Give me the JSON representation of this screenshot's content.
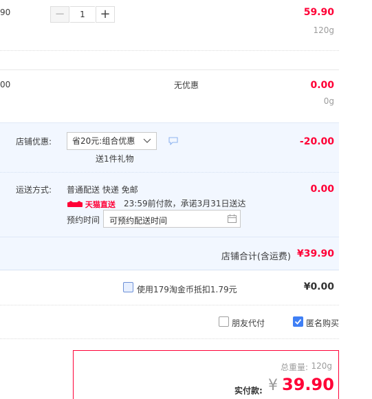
{
  "item1": {
    "price_partial": "90",
    "quantity": "1",
    "minus": "−",
    "plus": "+",
    "total": "59.90",
    "weight": "120g"
  },
  "item2": {
    "price_partial": "00",
    "promo": "无优惠",
    "total": "0.00",
    "weight": "0g"
  },
  "shop_discount": {
    "label": "店铺优惠:",
    "selected": "省20元:组合优惠",
    "gift": "送1件礼物",
    "amount": "-20.00"
  },
  "shipping": {
    "label": "运送方式:",
    "method": "普通配送 快递 免邮",
    "badge": "天猫直送",
    "promise": "23:59前付款，承诺3月31日送达",
    "schedule_label": "预约时间",
    "schedule_placeholder": "可预约配送时间",
    "amount": "0.00"
  },
  "shop_total": {
    "label": "店铺合计(含运费)",
    "amount": "¥39.90"
  },
  "coin": {
    "label": "使用179淘金币抵扣1.79元",
    "amount": "¥0.00"
  },
  "options": {
    "friend_pay": "朋友代付",
    "anonymous": "匿名购买"
  },
  "summary": {
    "weight_label": "总重量:",
    "weight": "120g",
    "pay_label": "实付款:",
    "currency": "¥",
    "amount": "39.90"
  },
  "colors": {
    "accent_red": "#ff0036",
    "light_blue": "#f2f7ff",
    "check_blue": "#3f7ff5"
  },
  "icons": {
    "chat": "chat-bubble-icon",
    "calendar": "calendar-icon",
    "tmall": "tmall-cat-icon",
    "chevron": "chevron-down-icon"
  }
}
